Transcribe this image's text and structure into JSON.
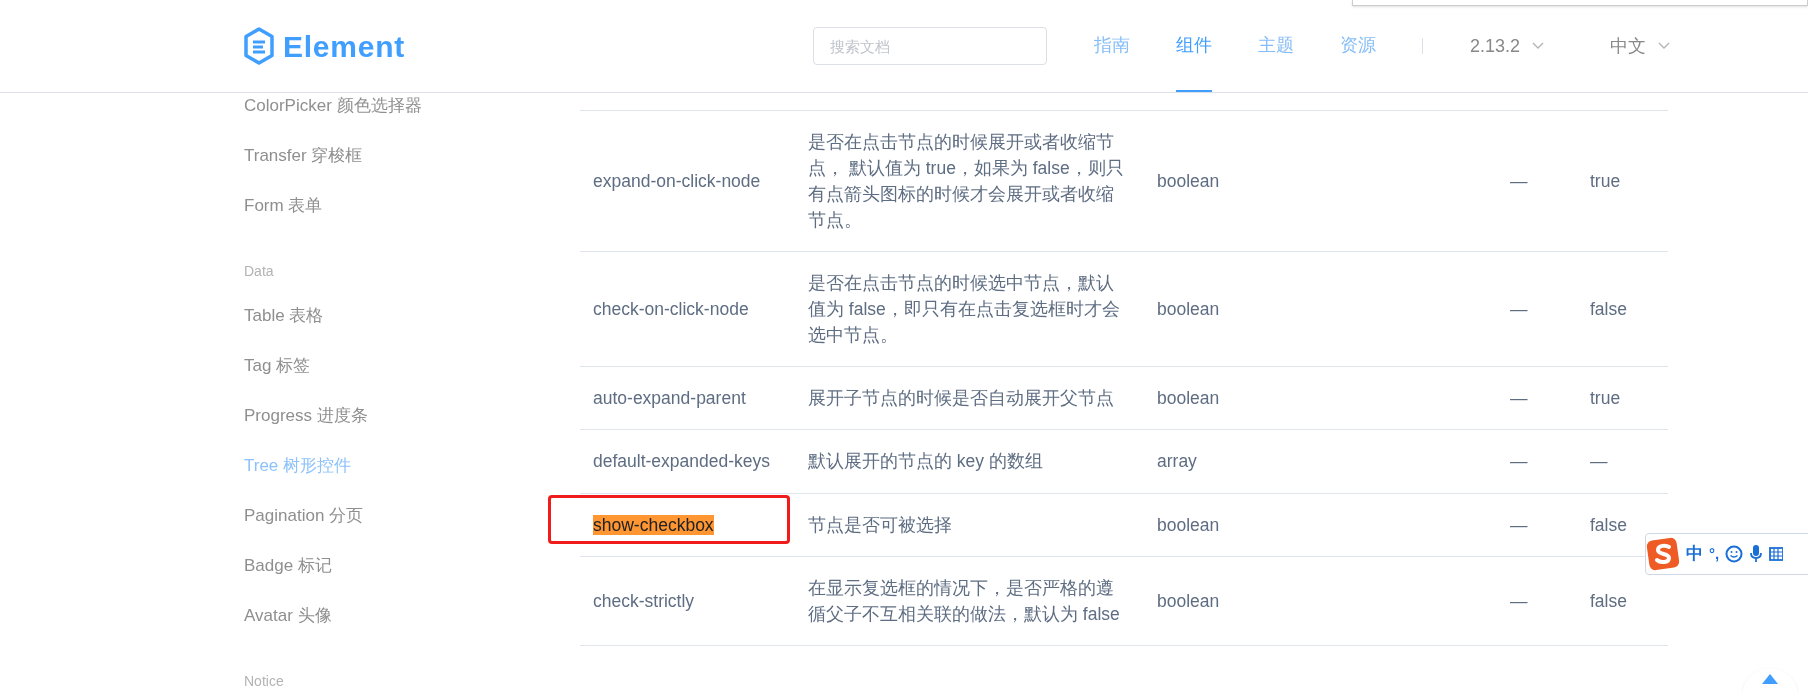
{
  "header": {
    "logo": "Element",
    "search": {
      "placeholder": "搜索文档"
    },
    "nav": [
      {
        "label": "指南",
        "selected": false
      },
      {
        "label": "组件",
        "selected": true
      },
      {
        "label": "主题",
        "selected": false
      },
      {
        "label": "资源",
        "selected": false
      }
    ],
    "version": "2.13.2",
    "language": "中文"
  },
  "sidebar": {
    "items": [
      {
        "kind": "item",
        "label": "ColorPicker 颜色选择器",
        "selected": false
      },
      {
        "kind": "item",
        "label": "Transfer 穿梭框",
        "selected": false
      },
      {
        "kind": "item",
        "label": "Form 表单",
        "selected": false
      },
      {
        "kind": "group",
        "label": "Data"
      },
      {
        "kind": "item",
        "label": "Table 表格",
        "selected": false
      },
      {
        "kind": "item",
        "label": "Tag 标签",
        "selected": false
      },
      {
        "kind": "item",
        "label": "Progress 进度条",
        "selected": false
      },
      {
        "kind": "item",
        "label": "Tree 树形控件",
        "selected": true
      },
      {
        "kind": "item",
        "label": "Pagination 分页",
        "selected": false
      },
      {
        "kind": "item",
        "label": "Badge 标记",
        "selected": false
      },
      {
        "kind": "item",
        "label": "Avatar 头像",
        "selected": false
      },
      {
        "kind": "group",
        "label": "Notice"
      }
    ]
  },
  "table": {
    "rows": [
      {
        "name": "expand-on-click-node",
        "description": "是否在点击节点的时候展开或者收缩节点， 默认值为 true，如果为 false，则只有点箭头图标的时候才会展开或者收缩节点。",
        "type": "boolean",
        "options": "—",
        "default": "true",
        "highlighted": false,
        "boxed": false
      },
      {
        "name": "check-on-click-node",
        "description": "是否在点击节点的时候选中节点，默认值为 false，即只有在点击复选框时才会选中节点。",
        "type": "boolean",
        "options": "—",
        "default": "false",
        "highlighted": false,
        "boxed": false
      },
      {
        "name": "auto-expand-parent",
        "description": "展开子节点的时候是否自动展开父节点",
        "type": "boolean",
        "options": "—",
        "default": "true",
        "highlighted": false,
        "boxed": false
      },
      {
        "name": "default-expanded-keys",
        "description": "默认展开的节点的 key 的数组",
        "type": "array",
        "options": "—",
        "default": "—",
        "highlighted": false,
        "boxed": false
      },
      {
        "name": "show-checkbox",
        "description": "节点是否可被选择",
        "type": "boolean",
        "options": "—",
        "default": "false",
        "highlighted": true,
        "boxed": true
      },
      {
        "name": "check-strictly",
        "description": "在显示复选框的情况下，是否严格的遵循父子不互相关联的做法，默认为 false",
        "type": "boolean",
        "options": "—",
        "default": "false",
        "highlighted": false,
        "boxed": false
      }
    ]
  },
  "ime_toolbar": {
    "mode": "中",
    "punctuation": "°,"
  }
}
